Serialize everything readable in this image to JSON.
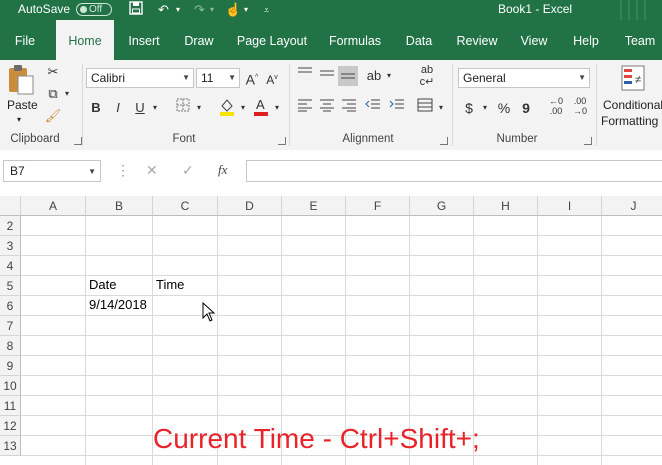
{
  "titlebar": {
    "autosave_label": "AutoSave",
    "autosave_state": "Off",
    "title": "Book1  -  Excel",
    "save_icon": "save-icon",
    "undo_icon": "undo-icon",
    "redo_icon": "redo-icon",
    "touch_icon": "touch-mode-icon",
    "more_icon": "customize-qat-icon"
  },
  "tabs": [
    "File",
    "Home",
    "Insert",
    "Draw",
    "Page Layout",
    "Formulas",
    "Data",
    "Review",
    "View",
    "Help",
    "Team"
  ],
  "active_tab": "Home",
  "ribbon": {
    "clipboard": {
      "paste": "Paste",
      "label": "Clipboard"
    },
    "font": {
      "name": "Calibri",
      "size": "11",
      "bold": "B",
      "italic": "I",
      "underline": "U",
      "label": "Font"
    },
    "alignment": {
      "label": "Alignment"
    },
    "number": {
      "format": "General",
      "currency": "$",
      "percent": "%",
      "comma": "9",
      "label": "Number"
    },
    "styles": {
      "conditional_line1": "Conditional",
      "conditional_line2": "Formatting"
    }
  },
  "formula_bar": {
    "name_box": "B7",
    "cancel": "✕",
    "enter": "✓",
    "fx": "fx",
    "value": ""
  },
  "grid": {
    "columns": [
      "A",
      "B",
      "C",
      "D",
      "E",
      "F",
      "G",
      "H",
      "I",
      "J"
    ],
    "rows": [
      "2",
      "3",
      "4",
      "5",
      "6",
      "7",
      "8",
      "9",
      "10",
      "11",
      "12",
      "13"
    ],
    "cells": {
      "B5": "Date",
      "C5": "Time",
      "B6": "9/14/2018"
    }
  },
  "caption": "Current Time - Ctrl+Shift+;",
  "colors": {
    "excel_green": "#217346",
    "caption_red": "#e8232a"
  }
}
